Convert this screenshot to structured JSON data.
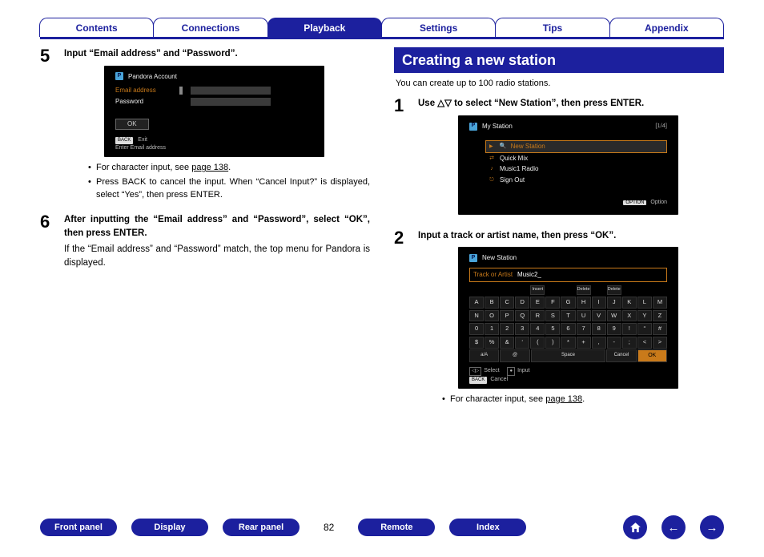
{
  "tabs": {
    "contents": "Contents",
    "connections": "Connections",
    "playback": "Playback",
    "settings": "Settings",
    "tips": "Tips",
    "appendix": "Appendix"
  },
  "left": {
    "step5": {
      "head": "Input “Email address” and “Password”.",
      "bullet1_a": "For character input, see ",
      "bullet1_link": "page 138",
      "bullet1_b": ".",
      "bullet2": "Press BACK to cancel the input. When “Cancel Input?” is displayed, select “Yes”, then press ENTER."
    },
    "step6": {
      "head": "After inputting the “Email address” and “Password”, select “OK”, then press ENTER.",
      "note": "If the “Email address” and “Password” match, the top menu for Pandora is displayed."
    },
    "screen1": {
      "title": "Pandora Account",
      "email_label": "Email address",
      "password_label": "Password",
      "ok": "OK",
      "back_tag": "BACK",
      "exit": "Exit",
      "hint": "Enter Email address"
    }
  },
  "right": {
    "heading": "Creating a new station",
    "intro": "You can create up to 100 radio stations.",
    "step1": {
      "head": "Use △▽ to select “New Station”, then press ENTER."
    },
    "step2": {
      "head": "Input a track or artist name, then press “OK”.",
      "bullet_a": "For character input, see ",
      "bullet_link": "page 138",
      "bullet_b": "."
    },
    "screen2": {
      "title": "My Station",
      "counter": "[1/4]",
      "items": {
        "new_station": "New Station",
        "quick_mix": "Quick Mix",
        "music1": "Music1 Radio",
        "sign_out": "Sign Out"
      },
      "option_tag": "OPTION",
      "option": "Option"
    },
    "screen3": {
      "title": "New Station",
      "search_label": "Track or Artist",
      "search_value": "Music2_",
      "row0": {
        "k0": "Insert",
        "k1": "Delete",
        "k2": "Delete"
      },
      "keys_row1": [
        "A",
        "B",
        "C",
        "D",
        "E",
        "F",
        "G",
        "H",
        "I",
        "J",
        "K",
        "L",
        "M"
      ],
      "keys_row2": [
        "N",
        "O",
        "P",
        "Q",
        "R",
        "S",
        "T",
        "U",
        "V",
        "W",
        "X",
        "Y",
        "Z"
      ],
      "keys_row3": [
        "0",
        "1",
        "2",
        "3",
        "4",
        "5",
        "6",
        "7",
        "8",
        "9",
        "!",
        "“",
        "#"
      ],
      "keys_row4": [
        "$",
        "%",
        "&",
        "‘",
        "(",
        ")",
        "*",
        "+",
        ",",
        "-",
        ";",
        "<",
        ">"
      ],
      "row5": {
        "aA": "a/A",
        "at": "@",
        "space": "Space",
        "cancel": "Cancel",
        "ok": "OK"
      },
      "legend": {
        "select": "Select",
        "input": "Input",
        "back_tag": "BACK",
        "cancel": "Cancel"
      }
    }
  },
  "footer": {
    "front_panel": "Front panel",
    "display": "Display",
    "rear_panel": "Rear panel",
    "page": "82",
    "remote": "Remote",
    "index": "Index"
  }
}
